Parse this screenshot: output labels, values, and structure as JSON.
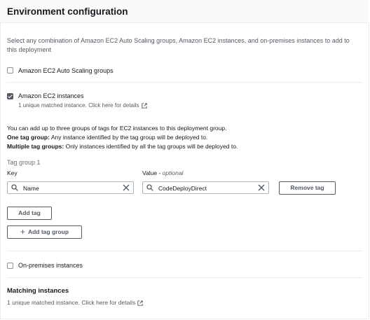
{
  "header": {
    "title": "Environment configuration"
  },
  "description": "Select any combination of Amazon EC2 Auto Scaling groups, Amazon EC2 instances, and on-premises instances to add to this deployment",
  "options": {
    "auto_scaling": {
      "label": "Amazon EC2 Auto Scaling groups",
      "checked": false
    },
    "ec2": {
      "label": "Amazon EC2 instances",
      "checked": true,
      "hint": "1 unique matched instance. Click here for details"
    },
    "on_prem": {
      "label": "On-premises instances",
      "checked": false
    }
  },
  "tag_info": {
    "line1": "You can add up to three groups of tags for EC2 instances to this deployment group.",
    "one_bold": "One tag group:",
    "one_rest": " Any instance identified by the tag group will be deployed to.",
    "multi_bold": "Multiple tag groups:",
    "multi_rest": " Only instances identified by all the tag groups will be deployed to."
  },
  "tag_group": {
    "title": "Tag group 1",
    "key_label": "Key",
    "value_label": "Value - ",
    "value_optional": "optional",
    "key_value": "Name",
    "value_value": "CodeDeployDirect",
    "remove_label": "Remove tag"
  },
  "buttons": {
    "add_tag": "Add tag",
    "add_tag_group": "Add tag group"
  },
  "matching": {
    "title": "Matching instances",
    "hint": "1 unique matched instance. Click here for details"
  },
  "colors": {
    "text": "#16191f",
    "muted": "#545b64",
    "border": "#aab7b8",
    "divider": "#eaeded"
  }
}
